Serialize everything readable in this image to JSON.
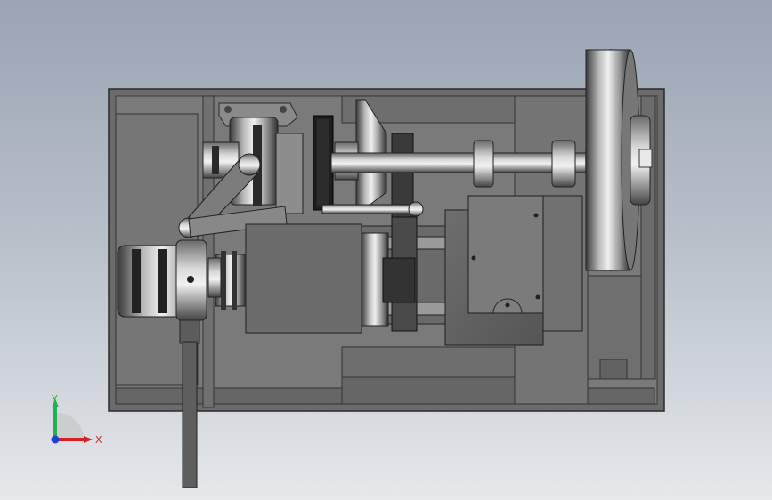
{
  "viewport": {
    "title": "",
    "triad": {
      "x_label": "X",
      "y_label": "Y",
      "x_color": "#d81f1f",
      "y_color": "#22b14c",
      "z_color": "#1e3fd8"
    }
  },
  "model": {
    "name": "",
    "components": [
      "frame",
      "flywheel",
      "main-shaft",
      "v-belt-pulley",
      "motor",
      "clutch-housing",
      "crank-lever",
      "operating-handle",
      "sprocket",
      "cone-pulley",
      "slide-block"
    ]
  }
}
